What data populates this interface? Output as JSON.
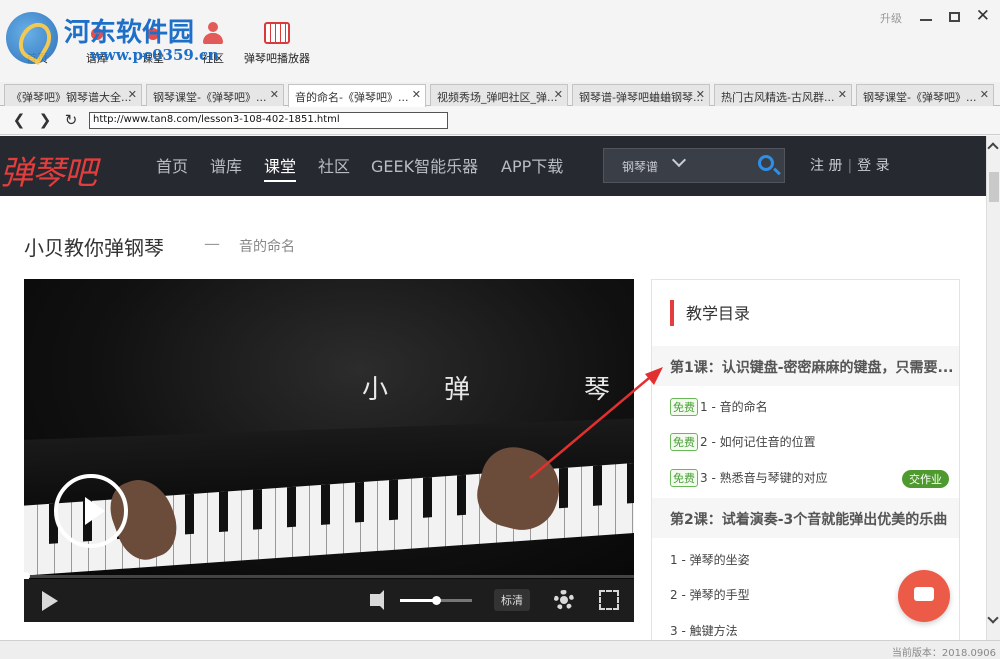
{
  "watermark": {
    "name": "河东软件园",
    "url": "www.pc0359.cn"
  },
  "toolbar": {
    "items": [
      {
        "label": "首页"
      },
      {
        "label": "谱库"
      },
      {
        "label": "课堂"
      },
      {
        "label": "社区"
      },
      {
        "label": "弹琴吧播放器"
      }
    ],
    "upgrade": "升级",
    "close": "✕"
  },
  "tabs": [
    {
      "label": "《弹琴吧》钢琴谱大全...",
      "close": "✕"
    },
    {
      "label": "钢琴课堂-《弹琴吧》...",
      "close": "✕"
    },
    {
      "label": "音的命名-《弹琴吧》...",
      "close": "✕"
    },
    {
      "label": "视频秀场_弹吧社区_弹...",
      "close": "✕"
    },
    {
      "label": "钢琴谱-弹琴吧蛐蛐钢琴...",
      "close": "✕"
    },
    {
      "label": "热门古风精选-古风群...",
      "close": "✕"
    },
    {
      "label": "钢琴课堂-《弹琴吧》...",
      "close": "✕"
    }
  ],
  "addressbar": {
    "back": "❮",
    "forward": "❯",
    "refresh": "↻",
    "url": "http://www.tan8.com/lesson3-108-402-1851.html"
  },
  "site": {
    "logo": "弹琴吧",
    "nav": [
      "首页",
      "谱库",
      "课堂",
      "社区",
      "GEEK智能乐器",
      "APP下载"
    ],
    "search_select": "钢琴谱",
    "register": "注 册",
    "login": "登 录",
    "auth_sep": "|"
  },
  "page": {
    "title": "小贝教你弹钢琴",
    "dash": "—",
    "subtitle": "音的命名"
  },
  "video": {
    "caption": [
      "小",
      "弹",
      "琴"
    ],
    "quality": "标清",
    "volume": 0.5
  },
  "sidebar": {
    "heading": "教学目录",
    "lessons": [
      {
        "title": "第1课：认识键盘-密密麻麻的键盘，只需要...",
        "items": [
          {
            "free": "免费",
            "label": "1 - 音的命名"
          },
          {
            "free": "免费",
            "label": "2 - 如何记住音的位置"
          },
          {
            "free": "免费",
            "label": "3 - 熟悉音与琴键的对应",
            "badge": "交作业"
          }
        ]
      },
      {
        "title": "第2课：试着演奏-3个音就能弹出优美的乐曲",
        "items": [
          {
            "label": "1 - 弹琴的坐姿"
          },
          {
            "label": "2 - 弹琴的手型"
          },
          {
            "label": "3 - 触键方法"
          }
        ]
      }
    ]
  },
  "statusbar": {
    "version": "当前版本：2018.0906"
  },
  "colors": {
    "accent": "#e33d3d",
    "header_bg": "#26292f",
    "free_green": "#4aa03a",
    "chat": "#ec5a48"
  }
}
